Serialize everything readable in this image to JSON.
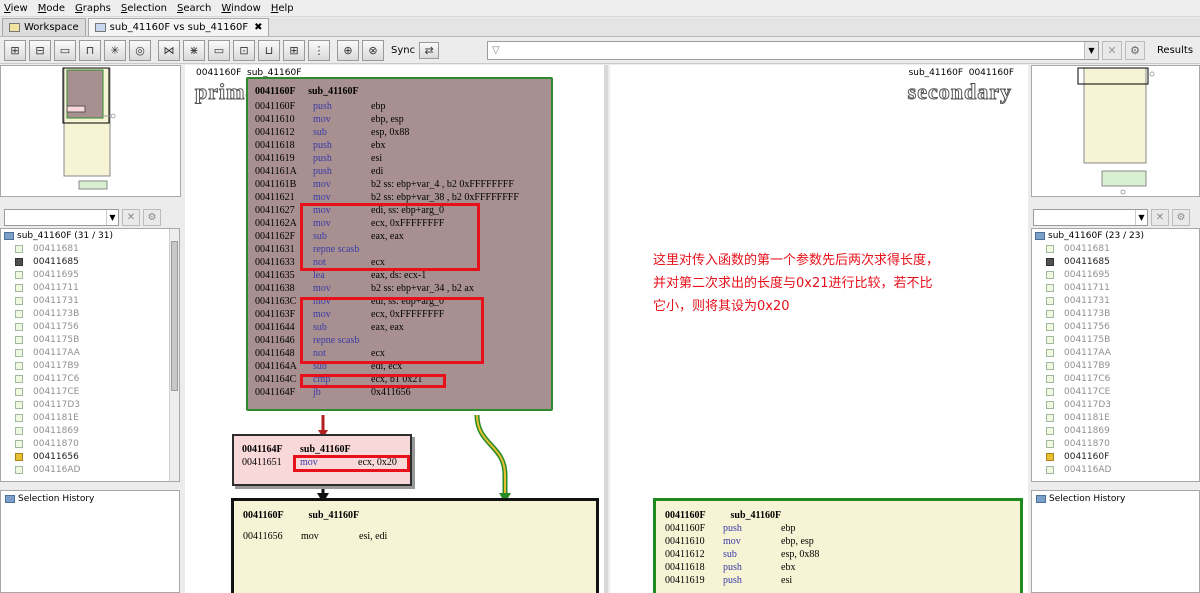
{
  "menu": [
    "View",
    "Mode",
    "Graphs",
    "Selection",
    "Search",
    "Window",
    "Help"
  ],
  "tabs": [
    {
      "label": "Workspace",
      "active": false
    },
    {
      "label": "sub_41160F vs sub_41160F",
      "active": true,
      "close": "✖"
    }
  ],
  "toolbar": {
    "sync_label": "Sync",
    "search_value": "",
    "search_icon": "▽",
    "clear_icon": "✕",
    "gear_icon": "⚙",
    "results_label": "Results",
    "buttons": [
      "⊞",
      "⊟",
      "▭",
      "⊓",
      "✳",
      "◎",
      "⋈",
      "⋇",
      "▭",
      "⊡",
      "⊔",
      "⊞",
      "⋮",
      "⊕",
      "⊗"
    ]
  },
  "left_tree": {
    "root": "sub_41160F (31 / 31)",
    "items": [
      {
        "label": "00411681",
        "style": "light"
      },
      {
        "label": "00411685",
        "style": "dark"
      },
      {
        "label": "00411695",
        "style": "light"
      },
      {
        "label": "00411711",
        "style": "light"
      },
      {
        "label": "00411731",
        "style": "light"
      },
      {
        "label": "0041173B",
        "style": "light"
      },
      {
        "label": "00411756",
        "style": "light"
      },
      {
        "label": "0041175B",
        "style": "light"
      },
      {
        "label": "004117AA",
        "style": "light"
      },
      {
        "label": "004117B9",
        "style": "light"
      },
      {
        "label": "004117C6",
        "style": "light"
      },
      {
        "label": "004117CE",
        "style": "light"
      },
      {
        "label": "004117D3",
        "style": "light"
      },
      {
        "label": "0041181E",
        "style": "light"
      },
      {
        "label": "00411869",
        "style": "light"
      },
      {
        "label": "00411870",
        "style": "light"
      },
      {
        "label": "00411656",
        "style": "yellow"
      },
      {
        "label": "004116AD",
        "style": "light"
      }
    ]
  },
  "right_tree": {
    "root": "sub_41160F (23 / 23)",
    "items": [
      {
        "label": "00411681",
        "style": "light"
      },
      {
        "label": "00411685",
        "style": "dark"
      },
      {
        "label": "00411695",
        "style": "light"
      },
      {
        "label": "00411711",
        "style": "light"
      },
      {
        "label": "00411731",
        "style": "light"
      },
      {
        "label": "0041173B",
        "style": "light"
      },
      {
        "label": "00411756",
        "style": "light"
      },
      {
        "label": "0041175B",
        "style": "light"
      },
      {
        "label": "004117AA",
        "style": "light"
      },
      {
        "label": "004117B9",
        "style": "light"
      },
      {
        "label": "004117C6",
        "style": "light"
      },
      {
        "label": "004117CE",
        "style": "light"
      },
      {
        "label": "004117D3",
        "style": "light"
      },
      {
        "label": "0041181E",
        "style": "light"
      },
      {
        "label": "00411869",
        "style": "light"
      },
      {
        "label": "00411870",
        "style": "light"
      },
      {
        "label": "0041160F",
        "style": "yellow"
      },
      {
        "label": "004116AD",
        "style": "light"
      }
    ]
  },
  "history_label": "Selection History",
  "primary": {
    "header_left": "0041160F",
    "header_right": "sub_41160F",
    "big_label": "primary",
    "main_block": {
      "title_addr": "0041160F",
      "title_name": "sub_41160F",
      "rows": [
        {
          "addr": "0041160F",
          "op": "push",
          "args": "ebp"
        },
        {
          "addr": "00411610",
          "op": "mov",
          "args": "ebp, esp"
        },
        {
          "addr": "00411612",
          "op": "sub",
          "args": "esp, 0x88"
        },
        {
          "addr": "00411618",
          "op": "push",
          "args": "ebx"
        },
        {
          "addr": "00411619",
          "op": "push",
          "args": "esi"
        },
        {
          "addr": "0041161A",
          "op": "push",
          "args": "edi"
        },
        {
          "addr": "0041161B",
          "op": "mov",
          "args": "b2 ss: ebp+var_4 , b2 0xFFFFFFFF"
        },
        {
          "addr": "00411621",
          "op": "mov",
          "args": "b2 ss: ebp+var_38 , b2 0xFFFFFFFF"
        },
        {
          "addr": "00411627",
          "op": "mov",
          "args": "edi, ss: ebp+arg_0"
        },
        {
          "addr": "0041162A",
          "op": "mov",
          "args": "ecx, 0xFFFFFFFF"
        },
        {
          "addr": "0041162F",
          "op": "sub",
          "args": "eax, eax"
        },
        {
          "addr": "00411631",
          "op": "repne scasb",
          "args": ""
        },
        {
          "addr": "00411633",
          "op": "not",
          "args": "ecx"
        },
        {
          "addr": "00411635",
          "op": "lea",
          "args": "eax, ds: ecx-1"
        },
        {
          "addr": "00411638",
          "op": "mov",
          "args": "b2 ss: ebp+var_34 , b2 ax"
        },
        {
          "addr": "0041163C",
          "op": "mov",
          "args": "edi, ss: ebp+arg_0"
        },
        {
          "addr": "0041163F",
          "op": "mov",
          "args": "ecx, 0xFFFFFFFF"
        },
        {
          "addr": "00411644",
          "op": "sub",
          "args": "eax, eax"
        },
        {
          "addr": "00411646",
          "op": "repne scasb",
          "args": ""
        },
        {
          "addr": "00411648",
          "op": "not",
          "args": "ecx"
        },
        {
          "addr": "0041164A",
          "op": "sub",
          "args": "edi, ecx"
        },
        {
          "addr": "0041164C",
          "op": "cmp",
          "args": "ecx, b1 0x21"
        },
        {
          "addr": "0041164F",
          "op": "jb",
          "args": "0x411656"
        }
      ]
    },
    "pink_block": {
      "title_addr": "0041164F",
      "title_name": "sub_41160F",
      "rows": [
        {
          "addr": "00411651",
          "op": "mov",
          "args": "ecx, 0x20"
        }
      ]
    },
    "bottom_block": {
      "title_addr": "0041160F",
      "title_name": "sub_41160F",
      "rows": [
        {
          "addr": "00411656",
          "op": "mov",
          "args": "esi, edi"
        }
      ]
    }
  },
  "secondary": {
    "header_left": "sub_41160F",
    "header_right": "0041160F",
    "big_label": "secondary",
    "annotation": "这里对传入函数的第一个参数先后两次求得长度，并对第二次求出的长度与0x21进行比较，若不比它小，则将其设为0x20",
    "bottom_block": {
      "title_addr": "0041160F",
      "title_name": "sub_41160F",
      "rows": [
        {
          "addr": "0041160F",
          "op": "push",
          "args": "ebp"
        },
        {
          "addr": "00411610",
          "op": "mov",
          "args": "ebp, esp"
        },
        {
          "addr": "00411612",
          "op": "sub",
          "args": "esp, 0x88"
        },
        {
          "addr": "00411618",
          "op": "push",
          "args": "ebx"
        },
        {
          "addr": "00411619",
          "op": "push",
          "args": "esi"
        }
      ]
    }
  },
  "colors": {
    "highlight_red": "#e8101a",
    "match_green": "#2e8a2e",
    "main_block_bg": "#a89090",
    "pink_bg": "#f8d8d8",
    "yellow_bg": "#f6f4d4"
  }
}
